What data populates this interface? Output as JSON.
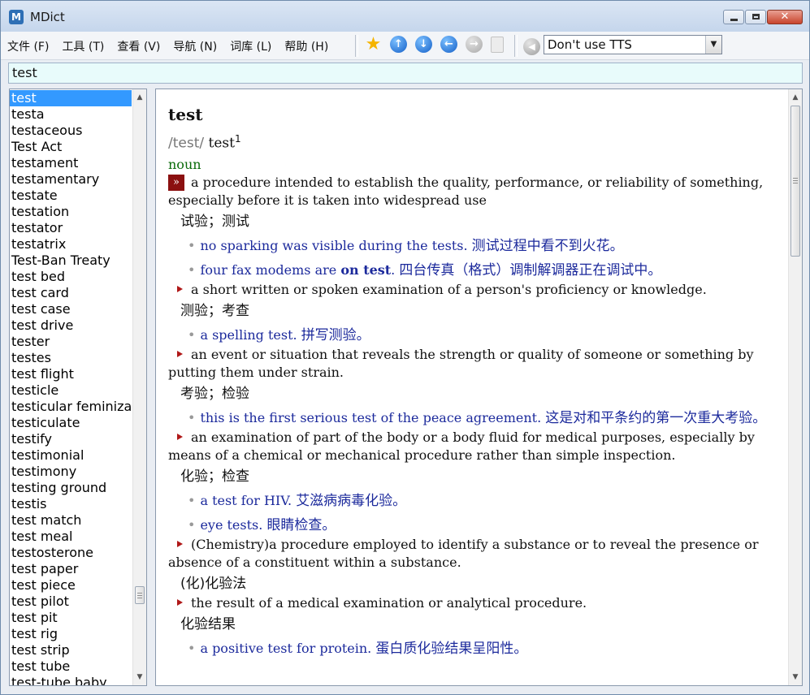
{
  "window": {
    "title": "MDict",
    "close_glyph": "✕"
  },
  "menu": {
    "file": "文件 (F)",
    "tools": "工具 (T)",
    "view": "查看 (V)",
    "navigate": "导航 (N)",
    "library": "词库 (L)",
    "help": "帮助 (H)"
  },
  "toolbar": {
    "icons": [
      "star-icon",
      "up-icon",
      "down-icon",
      "back-icon",
      "forward-icon",
      "clipboard-icon"
    ],
    "tts_value": "Don't use TTS"
  },
  "search": {
    "value": "test"
  },
  "wordlist": {
    "items": [
      "test",
      "testa",
      "testaceous",
      "Test Act",
      "testament",
      "testamentary",
      "testate",
      "testation",
      "testator",
      "testatrix",
      "Test-Ban Treaty",
      "test bed",
      "test card",
      "test case",
      "test drive",
      "tester",
      "testes",
      "test flight",
      "testicle",
      "testicular feminiza",
      "testiculate",
      "testify",
      "testimonial",
      "testimony",
      "testing ground",
      "testis",
      "test match",
      "test meal",
      "testosterone",
      "test paper",
      "test piece",
      "test pilot",
      "test pit",
      "test rig",
      "test strip",
      "test tube",
      "test-tube baby"
    ],
    "selected_index": 0
  },
  "entry": {
    "headword": "test",
    "pronunciation": "/test/",
    "homograph": "test",
    "homograph_number": "1",
    "pos": "noun",
    "first_marker": "»",
    "senses": [
      {
        "def": "a procedure intended to establish the quality, performance, or reliability of something, especially before it is taken into widespread use",
        "zh": "试验；测试",
        "examples": [
          {
            "en": "no sparking was visible during the tests.",
            "zh": "测试过程中看不到火花。"
          },
          {
            "en_pre": "four fax modems are ",
            "en_bold": "on test",
            "en_post": ".",
            "zh": "四台传真（格式）调制解调器正在调试中。"
          }
        ]
      },
      {
        "def": "a short written or spoken examination of a person's proficiency or knowledge.",
        "zh": "测验；考查",
        "examples": [
          {
            "en": "a spelling test.",
            "zh": "拼写测验。"
          }
        ]
      },
      {
        "def": "an event or situation that reveals the strength or quality of someone or something by putting them under strain.",
        "zh": "考验；检验",
        "examples": [
          {
            "en": "this is the first serious test of the peace agreement.",
            "zh": "这是对和平条约的第一次重大考验。"
          }
        ]
      },
      {
        "def": "an examination of part of the body or a body fluid for medical purposes, especially by means of a chemical or mechanical procedure rather than simple inspection.",
        "zh": "化验；检查",
        "examples": [
          {
            "en": "a test for HIV.",
            "zh": "艾滋病病毒化验。"
          },
          {
            "en": "eye tests.",
            "zh": "眼睛检查。"
          }
        ]
      },
      {
        "def": "(Chemistry)a procedure employed to identify a substance or to reveal the presence or absence of a constituent within a substance.",
        "zh": "(化)化验法",
        "examples": []
      },
      {
        "def": "the result of a medical examination or analytical procedure.",
        "zh": "化验结果",
        "examples": [
          {
            "en": "a positive test for protein.",
            "zh": "蛋白质化验结果呈阳性。"
          }
        ]
      }
    ]
  }
}
